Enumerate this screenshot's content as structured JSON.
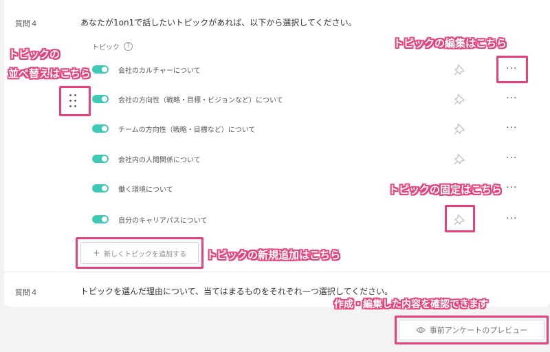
{
  "question1": {
    "label": "質問４",
    "text": "あなたが1on1で話したいトピックがあれば、以下から選択してください。"
  },
  "topics_header": "トピック",
  "help_icon": "?",
  "topics": [
    {
      "label": "会社のカルチャーについて"
    },
    {
      "label": "会社の方向性（戦略・目標・ビジョンなど）について"
    },
    {
      "label": "チームの方向性（戦略・目標など）について"
    },
    {
      "label": "会社内の人間関係について"
    },
    {
      "label": "働く環境について"
    },
    {
      "label": "自分のキャリアパスについて"
    }
  ],
  "more_label": "···",
  "add_topic_button": {
    "icon": "+",
    "label": "新しくトピックを追加する"
  },
  "question2": {
    "label": "質問４",
    "text": "トピックを選んだ理由について、当てはまるものをそれぞれ一つ選択してください。"
  },
  "preview_button": {
    "label": "事前アンケートのプレビュー"
  },
  "annotations": {
    "reorder_line1": "トピックの",
    "reorder_line2": "並べ替えはこちら",
    "edit": "トピックの編集はこちら",
    "pin": "トピックの固定はこちら",
    "add": "トピックの新規追加はこちら",
    "preview": "作成・編集した内容を確認できます"
  },
  "colors": {
    "accent": "#e8407a",
    "toggle_on": "#3ec9b7"
  }
}
